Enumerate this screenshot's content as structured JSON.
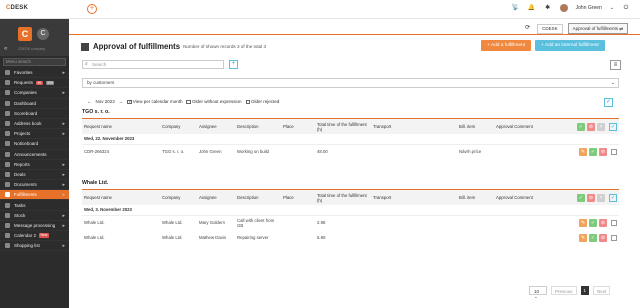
{
  "header": {
    "logo_prefix": "C",
    "logo_rest": "DESK",
    "plus_glyph": "+",
    "user_name": "John Green",
    "icons": [
      "satellite-icon",
      "bell-icon",
      "bug-icon",
      "user-avatar",
      "power-icon"
    ]
  },
  "sidebar": {
    "brand_sub": "CDESK company",
    "search_placeholder": "Menu search",
    "items": [
      {
        "label": "Favorites",
        "arrow": "▸"
      },
      {
        "label": "Requests",
        "badges": [
          "99",
          "999"
        ]
      },
      {
        "label": "Companies",
        "arrow": "▸"
      },
      {
        "label": "Dashboard"
      },
      {
        "label": "Scoreboard"
      },
      {
        "label": "Address book",
        "arrow": "▸"
      },
      {
        "label": "Projects",
        "arrow": "▸"
      },
      {
        "label": "Noticeboard"
      },
      {
        "label": "Announcements"
      },
      {
        "label": "Reports",
        "arrow": "▸"
      },
      {
        "label": "Deals",
        "arrow": "▸"
      },
      {
        "label": "Documents",
        "arrow": "▸"
      },
      {
        "label": "Fulfillments",
        "arrow": "▸",
        "active": true
      },
      {
        "label": "Tasks"
      },
      {
        "label": "Stock",
        "arrow": "▸"
      },
      {
        "label": "Message processing",
        "arrow": "▸"
      },
      {
        "label": "Calendar 2",
        "badges": [
          "New"
        ]
      },
      {
        "label": "Shopping list",
        "arrow": "▸"
      }
    ]
  },
  "tabs": {
    "refresh_glyph": "⟳",
    "items": [
      "CDESK",
      "Approval of fulfillments"
    ]
  },
  "page": {
    "title": "Approval of fulfillments",
    "subtitle": "Number of shown records 3 of the total 3",
    "btn_add": "+ Add a fulfillment",
    "btn_add_internal": "+ Add an internal fulfillment",
    "search_placeholder": "Search",
    "search_add_glyph": "+",
    "menu_glyph": "≡",
    "filter_value": "by customers",
    "filter_caret": "⌄",
    "month_prev": "←",
    "month_label": "Nov 2023",
    "month_next": "→",
    "check_view_per_month": "View per calendar month",
    "check_without_expression": "Older without expression",
    "check_rejected": "Older rejected",
    "check_glyph": "✓"
  },
  "groups": [
    {
      "name": "TGO s. r. o.",
      "columns": [
        "Request name",
        "Company",
        "Assignee",
        "Description",
        "Place",
        "Total time of the fulfillment (h)",
        "Transport",
        "Bill. item",
        "Approval Comment"
      ],
      "date": "Wed, 22. November 2023",
      "rows": [
        {
          "request": "CDR-266324",
          "company": "TGO s. r. o.",
          "assignee": "John Green",
          "description": "Working on build",
          "place": "",
          "time": "48.00",
          "transport": "",
          "bill_item": "Návrh príce",
          "comment": ""
        }
      ]
    },
    {
      "name": "Whale Ltd.",
      "columns": [
        "Request name",
        "Company",
        "Assignee",
        "Description",
        "Place",
        "Total time of the fulfillment (h)",
        "Transport",
        "Bill. item",
        "Approval Comment"
      ],
      "date": "Wed, 3. November 2023",
      "rows": [
        {
          "request": "Whale Ltd.",
          "company": "Whale Ltd.",
          "assignee": "Mary Goldern",
          "description": "Call with client from GB",
          "place": "",
          "time": "2.98",
          "transport": "",
          "bill_item": "",
          "comment": ""
        },
        {
          "request": "Whale Ltd.",
          "company": "Whale Ltd.",
          "assignee": "Mathew Davis",
          "description": "Repairing server",
          "place": "",
          "time": "5.80",
          "transport": "",
          "bill_item": "",
          "comment": ""
        }
      ]
    }
  ],
  "pager": {
    "per_page": "10",
    "prev": "Previous",
    "page": "1",
    "next": "Next"
  }
}
